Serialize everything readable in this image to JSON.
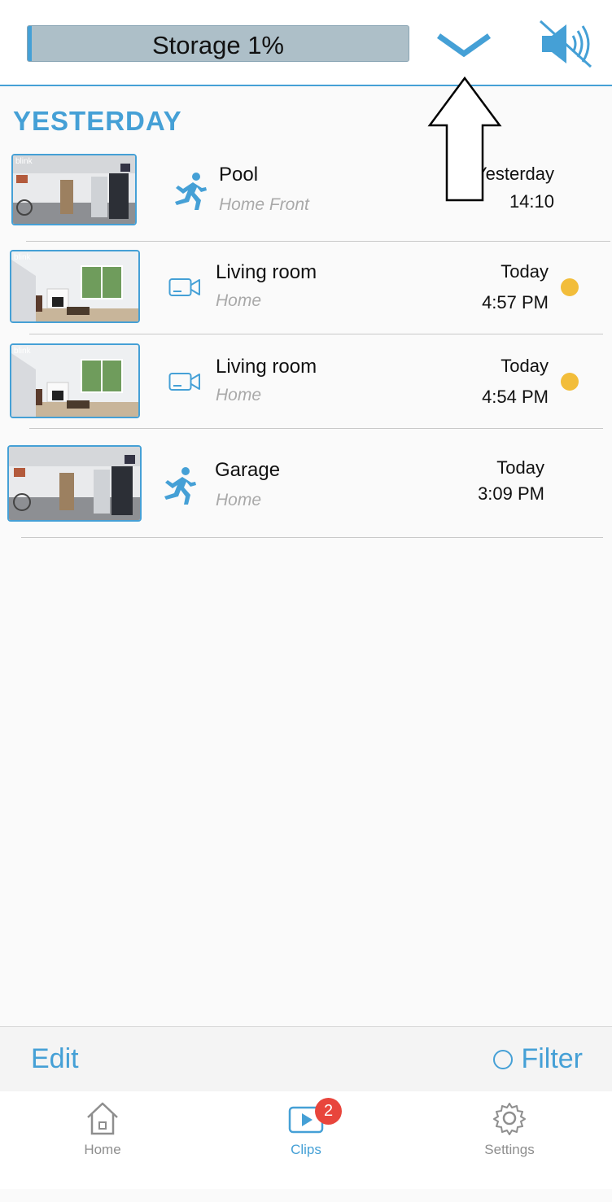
{
  "header": {
    "storage_label": "Storage 1%",
    "storage_percent": 1,
    "accent_color": "#45a0d6"
  },
  "section": {
    "title": "YESTERDAY"
  },
  "clips": [
    {
      "camera": "Pool",
      "network": "Home Front",
      "day": "Yesterday",
      "time": "14:10",
      "event_icon": "motion-runner-icon",
      "unseen": false
    },
    {
      "camera": "Living room",
      "network": "Home",
      "day": "Today",
      "time": "4:57 PM",
      "event_icon": "video-camera-icon",
      "unseen": true
    },
    {
      "camera": "Living room",
      "network": "Home",
      "day": "Today",
      "time": "4:54 PM",
      "event_icon": "video-camera-icon",
      "unseen": true
    },
    {
      "camera": "Garage",
      "network": "Home",
      "day": "Today",
      "time": "3:09 PM",
      "event_icon": "motion-runner-icon",
      "unseen": false
    }
  ],
  "thumb_brand": "blink",
  "actions": {
    "edit_label": "Edit",
    "filter_label": "Filter"
  },
  "tabs": [
    {
      "label": "Home",
      "icon": "house-icon",
      "active": false
    },
    {
      "label": "Clips",
      "icon": "play-clip-icon",
      "active": true,
      "badge": "2"
    },
    {
      "label": "Settings",
      "icon": "gear-icon",
      "active": false
    }
  ],
  "colors": {
    "unseen_dot": "#f2bd3a",
    "badge": "#e8453c",
    "storage_bar": "#adbfc8"
  }
}
